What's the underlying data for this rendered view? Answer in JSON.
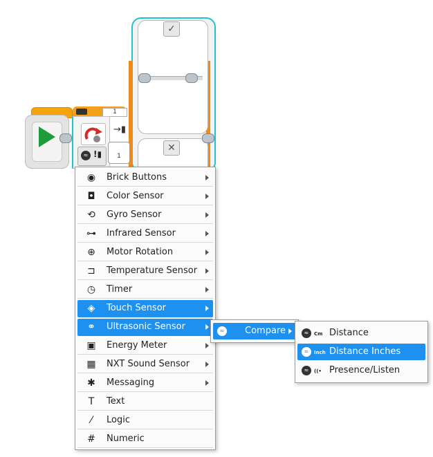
{
  "switch_block": {
    "top_number": "1",
    "plug_number": "1",
    "case_true_symbol": "✓",
    "case_false_symbol": "✕"
  },
  "icons": {
    "start": "play-icon",
    "loop": "loop-icon",
    "case_true": "check-icon",
    "case_false": "close-icon"
  },
  "colors": {
    "highlight": "#1e90f0",
    "outline": "#22c4cc",
    "start_play": "#1e9b3a",
    "case_frame": "#f08a1a"
  },
  "menu": {
    "items": [
      {
        "label": "Brick Buttons",
        "icon": "brick-buttons-icon",
        "glyph": "◉",
        "has_submenu": true
      },
      {
        "label": "Color Sensor",
        "icon": "color-sensor-icon",
        "glyph": "◘",
        "has_submenu": true
      },
      {
        "label": "Gyro Sensor",
        "icon": "gyro-sensor-icon",
        "glyph": "⟲",
        "has_submenu": true
      },
      {
        "label": "Infrared Sensor",
        "icon": "infrared-sensor-icon",
        "glyph": "⊶",
        "has_submenu": true
      },
      {
        "label": "Motor Rotation",
        "icon": "motor-rotation-icon",
        "glyph": "⊕",
        "has_submenu": true
      },
      {
        "label": "Temperature Sensor",
        "icon": "temperature-sensor-icon",
        "glyph": "⊐",
        "has_submenu": true
      },
      {
        "label": "Timer",
        "icon": "timer-icon",
        "glyph": "◷",
        "has_submenu": true
      },
      {
        "label": "Touch Sensor",
        "icon": "touch-sensor-icon",
        "glyph": "◈",
        "has_submenu": true,
        "selected": true
      },
      {
        "label": "Ultrasonic Sensor",
        "icon": "ultrasonic-sensor-icon",
        "glyph": "⚭",
        "has_submenu": true,
        "selected": true
      },
      {
        "label": "Energy Meter",
        "icon": "energy-meter-icon",
        "glyph": "▣",
        "has_submenu": true
      },
      {
        "label": "NXT Sound Sensor",
        "icon": "nxt-sound-sensor-icon",
        "glyph": "▦",
        "has_submenu": true
      },
      {
        "label": "Messaging",
        "icon": "messaging-icon",
        "glyph": "✱",
        "has_submenu": true
      },
      {
        "label": "Text",
        "icon": "text-icon",
        "glyph": "T",
        "has_submenu": false
      },
      {
        "label": "Logic",
        "icon": "logic-icon",
        "glyph": "⁄",
        "has_submenu": false
      },
      {
        "label": "Numeric",
        "icon": "numeric-icon",
        "glyph": "#",
        "has_submenu": false
      }
    ]
  },
  "submenu": {
    "label": "Compare",
    "icon": "ultrasonic-compare-icon",
    "glyph": "≈"
  },
  "submenu2": {
    "items": [
      {
        "label": "Distance Centimeters",
        "tag": "Cm",
        "icon": "distance-cm-icon"
      },
      {
        "label": "Distance Inches",
        "tag": "Inch",
        "icon": "distance-inch-icon",
        "selected": true
      },
      {
        "label": "Presence/Listen",
        "tag": "((•",
        "icon": "presence-listen-icon"
      }
    ]
  }
}
